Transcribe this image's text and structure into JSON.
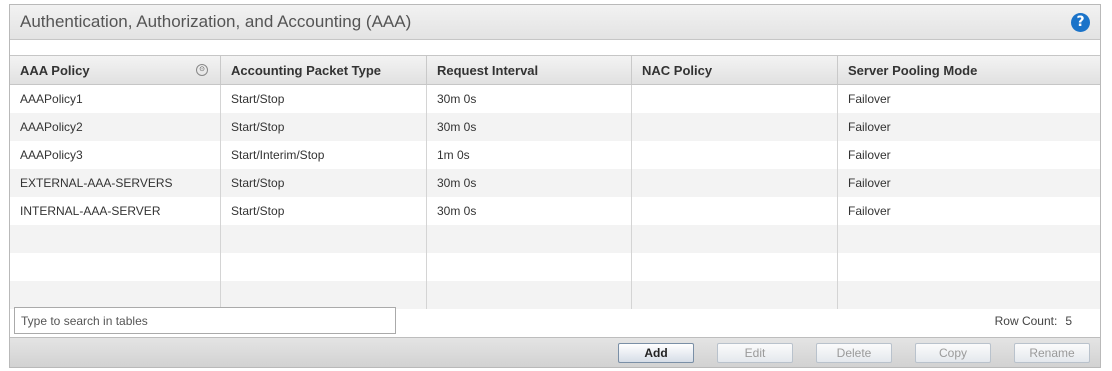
{
  "panel": {
    "title": "Authentication, Authorization, and Accounting (AAA)",
    "help_icon": "help-icon",
    "help_glyph": "?"
  },
  "table": {
    "columns": [
      "AAA Policy",
      "Accounting Packet Type",
      "Request Interval",
      "NAC Policy",
      "Server Pooling Mode"
    ],
    "sort_glyph": "⊙",
    "rows": [
      [
        "AAAPolicy1",
        "Start/Stop",
        "30m 0s",
        "",
        "Failover"
      ],
      [
        "AAAPolicy2",
        "Start/Stop",
        "30m 0s",
        "",
        "Failover"
      ],
      [
        "AAAPolicy3",
        "Start/Interim/Stop",
        "1m 0s",
        "",
        "Failover"
      ],
      [
        "EXTERNAL-AAA-SERVERS",
        "Start/Stop",
        "30m 0s",
        "",
        "Failover"
      ],
      [
        "INTERNAL-AAA-SERVER",
        "Start/Stop",
        "30m 0s",
        "",
        "Failover"
      ],
      [
        "",
        "",
        "",
        "",
        ""
      ],
      [
        "",
        "",
        "",
        "",
        ""
      ],
      [
        "",
        "",
        "",
        "",
        ""
      ]
    ]
  },
  "search": {
    "placeholder": "Type to search in tables"
  },
  "row_count": {
    "label": "Row Count:",
    "value": "5"
  },
  "buttons": {
    "add": "Add",
    "edit": "Edit",
    "delete": "Delete",
    "copy": "Copy",
    "rename": "Rename"
  },
  "colors": {
    "help_icon": "#1a73c9",
    "header_bg": "#e3e3e3",
    "row_alt": "#f3f3f3"
  }
}
